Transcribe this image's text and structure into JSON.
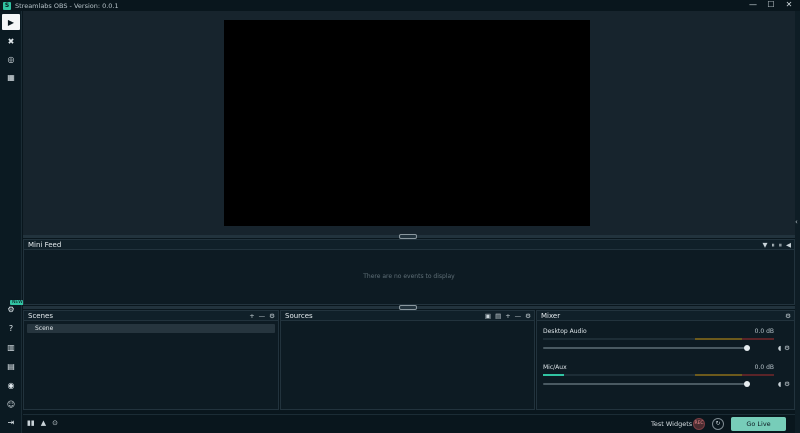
{
  "window": {
    "title": "Streamlabs OBS - Version: 0.0.1",
    "logo_letter": "S",
    "minimize": "—",
    "maximize": "☐",
    "close": "✕"
  },
  "nav": [
    {
      "id": "editor",
      "icon": "editor-icon",
      "glyph": "▶",
      "active": true
    },
    {
      "id": "themes",
      "icon": "themes-icon",
      "glyph": "✖"
    },
    {
      "id": "overlays",
      "icon": "overlays-icon",
      "glyph": "◎"
    },
    {
      "id": "store",
      "icon": "store-icon",
      "glyph": "▦"
    },
    {
      "id": "settings",
      "icon": "gear-icon",
      "glyph": "⚙"
    },
    {
      "id": "help",
      "icon": "help-icon",
      "glyph": "?"
    },
    {
      "id": "studio-mode",
      "icon": "studio-mode-icon",
      "glyph": "▥"
    },
    {
      "id": "layout",
      "icon": "layout-icon",
      "glyph": "▤"
    },
    {
      "id": "notifications",
      "icon": "bell-icon",
      "glyph": "◉"
    },
    {
      "id": "account",
      "icon": "account-icon",
      "glyph": "☺"
    },
    {
      "id": "logout",
      "icon": "logout-icon",
      "glyph": "⇥"
    }
  ],
  "nav_badge": "NEW",
  "mini_feed": {
    "title": "Mini Feed",
    "empty_text": "There are no events to display",
    "icons": [
      "▼",
      "⏸",
      "⏸",
      "◀"
    ]
  },
  "scenes": {
    "title": "Scenes",
    "items": [
      "Scene"
    ],
    "icons": [
      "+",
      "—",
      "⚙"
    ]
  },
  "sources": {
    "title": "Sources",
    "icons": [
      "▣",
      "▤",
      "+",
      "—",
      "⚙"
    ]
  },
  "mixer": {
    "title": "Mixer",
    "settings_glyph": "⚙",
    "channels": [
      {
        "name": "Desktop Audio",
        "db": "0.0 dB",
        "level": 0.0,
        "volume": 1.0
      },
      {
        "name": "Mic/Aux",
        "db": "0.0 dB",
        "level": 0.09,
        "volume": 1.0
      }
    ],
    "channel_icons": [
      "◖",
      "⚙"
    ]
  },
  "footer": {
    "left_icons": [
      "▮▮",
      "▲",
      "⊙"
    ],
    "test_widgets": "Test Widgets",
    "rec_label": "REC",
    "replay_glyph": "↻",
    "go_live": "Go Live"
  }
}
